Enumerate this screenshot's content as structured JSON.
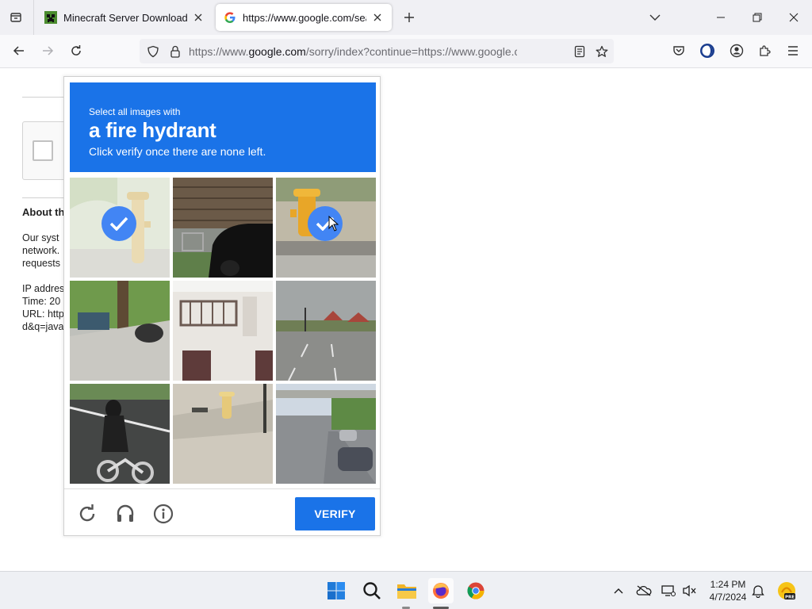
{
  "browser": {
    "tabs": [
      {
        "title": "Minecraft Server Download | Mi",
        "active": false
      },
      {
        "title": "https://www.google.com/searc",
        "active": true
      }
    ],
    "url": {
      "prefix": "https://www.",
      "domain": "google.com",
      "suffix": "/sorry/index?continue=https://www.google.com/searc"
    }
  },
  "page": {
    "about_heading": "About th",
    "paragraph": [
      "Our syst",
      "network.",
      "requests"
    ],
    "details": [
      "IP addres",
      "Time: 20",
      "URL: http",
      "d&q=java"
    ]
  },
  "captcha": {
    "instruction_line1": "Select all images with",
    "target": "a fire hydrant",
    "instruction_line3": "Click verify once there are none left.",
    "verify_label": "VERIFY",
    "tiles": [
      {
        "content": "fire hydrant on sidewalk",
        "selected": true
      },
      {
        "content": "car by fence",
        "selected": false
      },
      {
        "content": "yellow fire hydrant",
        "selected": true
      },
      {
        "content": "sidewalk with trees and motorcycle",
        "selected": false
      },
      {
        "content": "house with balcony",
        "selected": false
      },
      {
        "content": "road with houses",
        "selected": false
      },
      {
        "content": "motorcyclist on road",
        "selected": false
      },
      {
        "content": "fire hydrant on street corner",
        "selected": false
      },
      {
        "content": "road with cars and bridge",
        "selected": false
      }
    ]
  },
  "taskbar": {
    "time": "1:24 PM",
    "date": "4/7/2024"
  },
  "colors": {
    "captcha_blue": "#1a73e8",
    "check_blue": "#4285f4"
  }
}
